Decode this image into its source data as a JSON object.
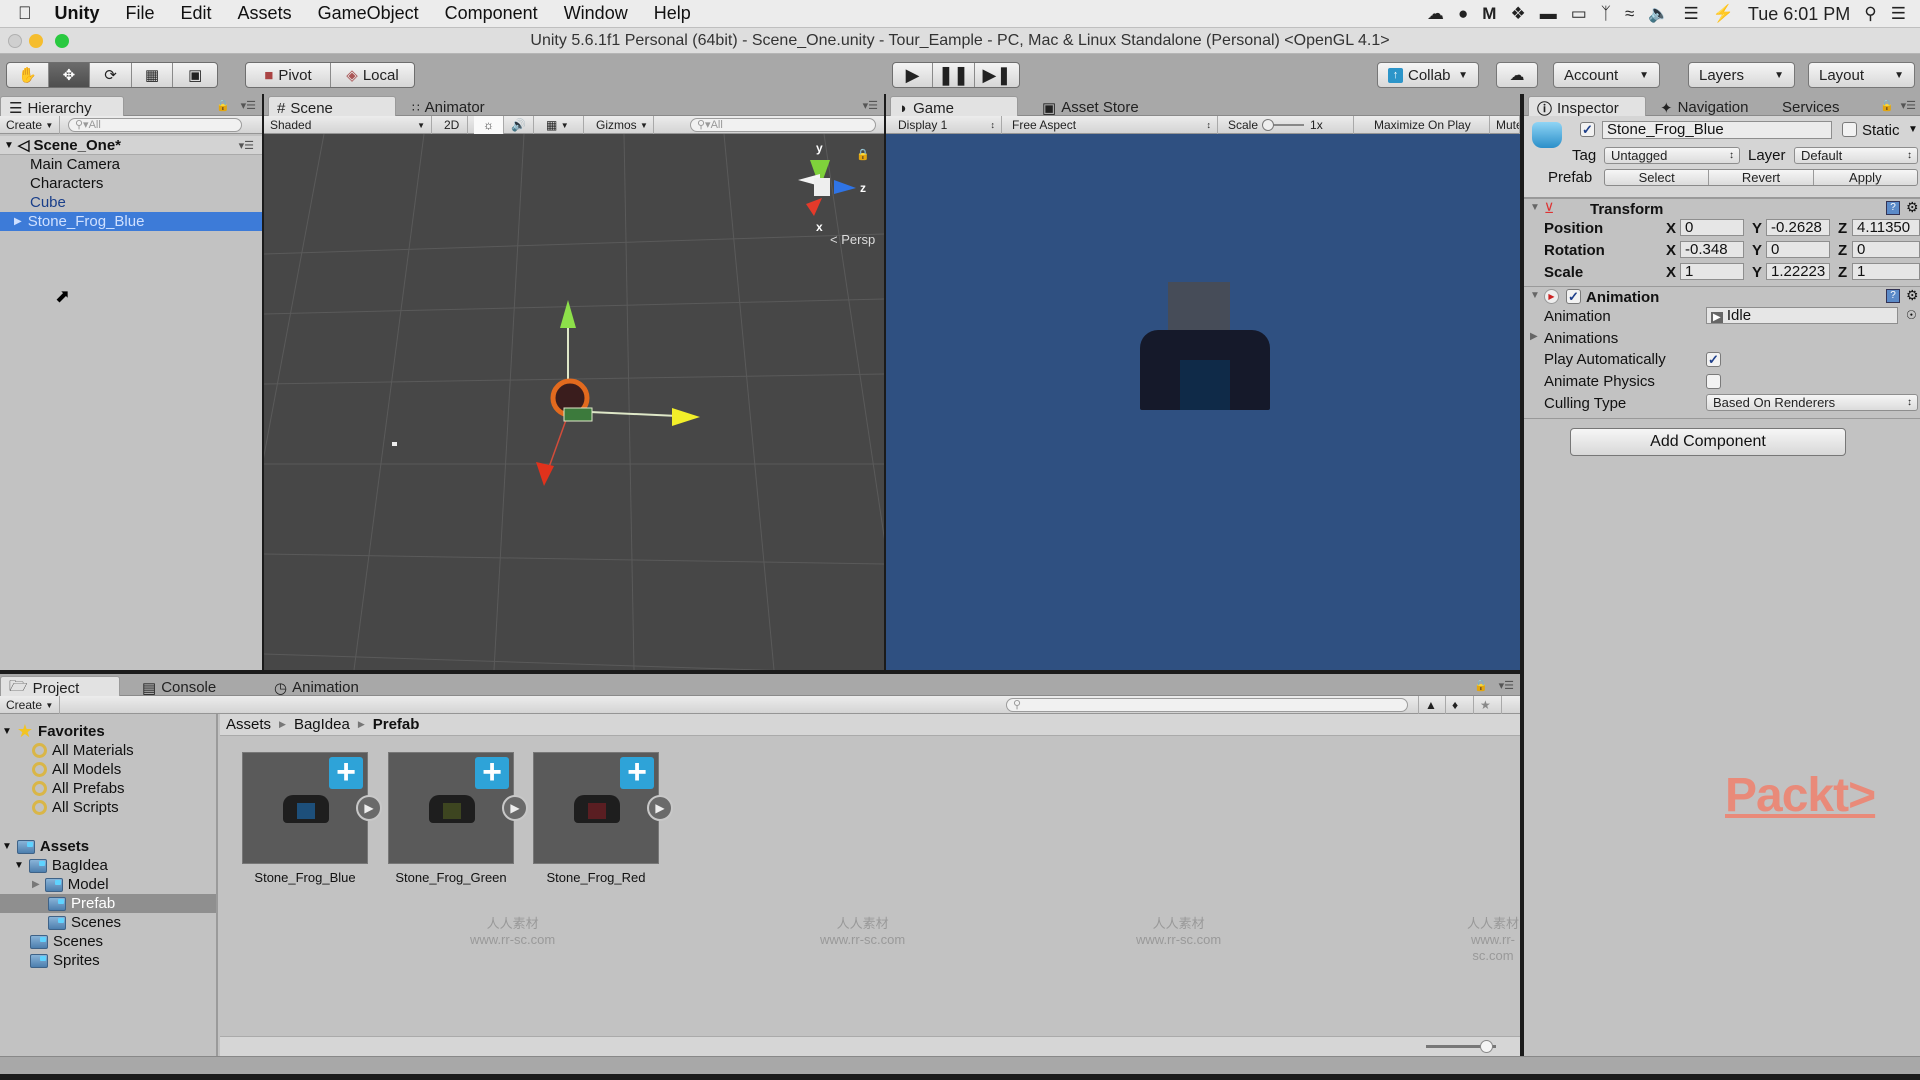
{
  "menubar": {
    "app": "Unity",
    "items": [
      "File",
      "Edit",
      "Assets",
      "GameObject",
      "Component",
      "Window",
      "Help"
    ],
    "clock": "Tue 6:01 PM",
    "status_icons": [
      "creative-cloud-icon",
      "chat-icon",
      "malwarebytes-icon",
      "dropbox-icon",
      "battery-bar-icon",
      "airplay-icon",
      "bluetooth-icon",
      "wifi-icon",
      "volume-icon",
      "flag-icon",
      "battery-charging-icon",
      "spotlight-search-icon",
      "notification-center-icon"
    ]
  },
  "window": {
    "title": "Unity 5.6.1f1 Personal (64bit) - Scene_One.unity - Tour_Eample - PC, Mac & Linux Standalone (Personal) <OpenGL 4.1>"
  },
  "toolbar": {
    "tools": [
      "hand-tool",
      "move-tool",
      "rotate-tool",
      "scale-tool",
      "rect-tool"
    ],
    "active_tool": "move-tool",
    "pivot_label": "Pivot",
    "local_label": "Local",
    "collab_label": "Collab",
    "account_label": "Account",
    "layers_label": "Layers",
    "layout_label": "Layout"
  },
  "hierarchy": {
    "tab_label": "Hierarchy",
    "create_label": "Create",
    "search_placeholder": "All",
    "scene_name": "Scene_One*",
    "items": [
      {
        "label": "Main Camera",
        "selected": false
      },
      {
        "label": "Characters",
        "selected": false
      },
      {
        "label": "Cube",
        "selected": false
      },
      {
        "label": "Stone_Frog_Blue",
        "selected": true
      }
    ]
  },
  "scene": {
    "tabs": [
      "Scene",
      "Animator"
    ],
    "shading_mode": "Shaded",
    "mode_2d_label": "2D",
    "gizmos_label": "Gizmos",
    "search_placeholder": "All",
    "projection_label": "Persp",
    "axis_labels": {
      "x": "x",
      "y": "y",
      "z": "z"
    }
  },
  "game": {
    "tabs": [
      "Game",
      "Asset Store"
    ],
    "display": "Display 1",
    "aspect": "Free Aspect",
    "scale_label": "Scale",
    "scale_value": "1x",
    "maximize_label": "Maximize On Play",
    "mute_label": "Mute"
  },
  "inspector": {
    "tabs": [
      "Inspector",
      "Navigation",
      "Services"
    ],
    "object_active": true,
    "object_name": "Stone_Frog_Blue",
    "static_label": "Static",
    "static_checked": false,
    "tag_label": "Tag",
    "tag_value": "Untagged",
    "layer_label": "Layer",
    "layer_value": "Default",
    "prefab_label": "Prefab",
    "prefab_buttons": [
      "Select",
      "Revert",
      "Apply"
    ],
    "transform": {
      "title": "Transform",
      "rows": [
        {
          "label": "Position",
          "x": "0",
          "y": "-0.2628",
          "z": "4.11350"
        },
        {
          "label": "Rotation",
          "x": "-0.348",
          "y": "0",
          "z": "0"
        },
        {
          "label": "Scale",
          "x": "1",
          "y": "1.22223",
          "z": "1"
        }
      ]
    },
    "animation": {
      "title": "Animation",
      "enabled": true,
      "animation_label": "Animation",
      "animation_value": "Idle",
      "animations_label": "Animations",
      "play_auto_label": "Play Automatically",
      "play_auto_checked": true,
      "animate_physics_label": "Animate Physics",
      "animate_physics_checked": false,
      "culling_label": "Culling Type",
      "culling_value": "Based On Renderers"
    },
    "add_component_label": "Add Component"
  },
  "project": {
    "tabs": [
      "Project",
      "Console",
      "Animation"
    ],
    "create_label": "Create",
    "favorites_label": "Favorites",
    "favorites": [
      "All Materials",
      "All Models",
      "All Prefabs",
      "All Scripts"
    ],
    "assets_label": "Assets",
    "tree": [
      {
        "label": "BagIdea",
        "depth": 1,
        "expanded": true
      },
      {
        "label": "Model",
        "depth": 2,
        "collapsed": true
      },
      {
        "label": "Prefab",
        "depth": 2,
        "selected": true
      },
      {
        "label": "Scenes",
        "depth": 2
      },
      {
        "label": "Scenes",
        "depth": 1
      },
      {
        "label": "Sprites",
        "depth": 1
      }
    ],
    "breadcrumb": [
      "Assets",
      "BagIdea",
      "Prefab"
    ],
    "assets": [
      {
        "name": "Stone_Frog_Blue",
        "color": "#1d4f7a"
      },
      {
        "name": "Stone_Frog_Green",
        "color": "#3d4520"
      },
      {
        "name": "Stone_Frog_Red",
        "color": "#5a1e22"
      }
    ],
    "thumbnail_size": 0.85
  },
  "watermark": {
    "brand": "Packt>",
    "site_cn": "人人素材",
    "site_url": "www.rr-sc.com"
  }
}
